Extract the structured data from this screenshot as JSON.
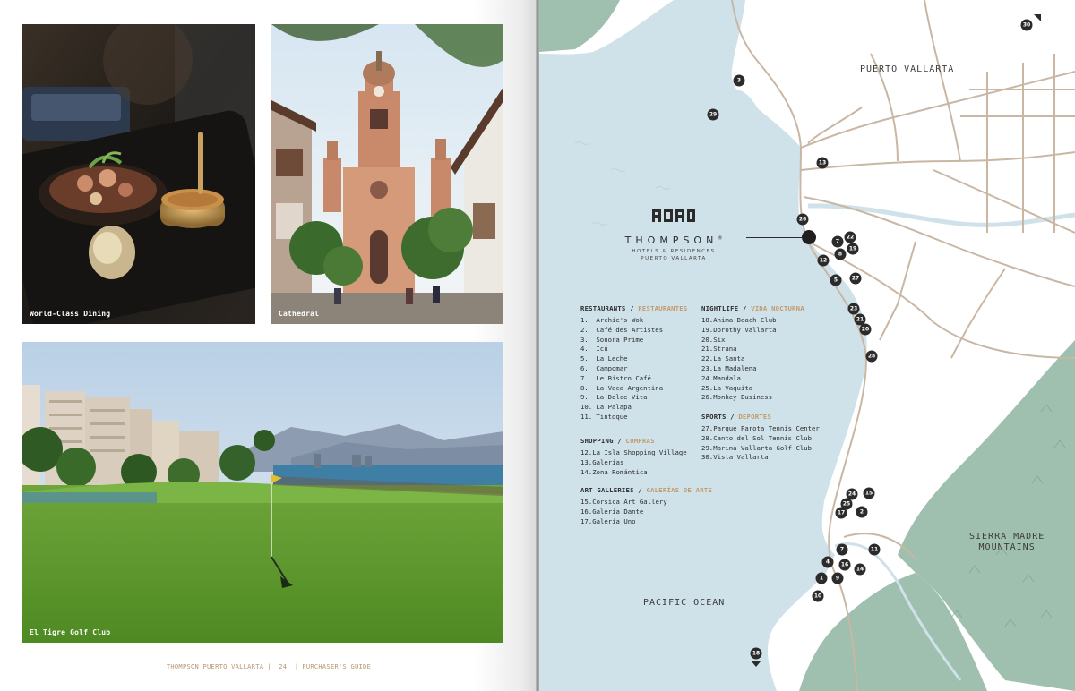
{
  "left_page": {
    "photos": [
      {
        "caption": "World-Class Dining"
      },
      {
        "caption": "Cathedral"
      },
      {
        "caption": "El Tigre Golf Club"
      }
    ],
    "footer": {
      "brand": "THOMPSON PUERTO VALLARTA",
      "separator": "|",
      "page_number": "24",
      "section": "PURCHASER'S GUIDE"
    }
  },
  "map": {
    "labels": {
      "city": "PUERTO VALLARTA",
      "ocean": "PACIFIC OCEAN",
      "mountains_line1": "SIERRA MADRE",
      "mountains_line2": "MOUNTAINS"
    },
    "brand": {
      "name": "THOMPSON",
      "registered": "®",
      "line1": "HOTELS & RESIDENCES",
      "line2": "PUERTO VALLARTA"
    },
    "markers": [
      "30",
      "3",
      "29",
      "13",
      "26",
      "22",
      "7",
      "19",
      "8",
      "12",
      "5",
      "27",
      "23",
      "21",
      "20",
      "28",
      "24",
      "15",
      "25",
      "17",
      "2",
      "7",
      "11",
      "4",
      "16",
      "14",
      "1",
      "9",
      "10",
      "18"
    ],
    "colors": {
      "water": "#cfe1e9",
      "land": "#ffffff",
      "mountains": "#9fbfaf",
      "roads": "#c9b7a4",
      "accent": "#c39a6b"
    }
  },
  "legend": {
    "restaurants": {
      "title_en": "RESTAURANTS",
      "slash": "/",
      "title_es": "RESTAURANTES",
      "items": [
        {
          "num": "1.",
          "name": "Archie's Wok"
        },
        {
          "num": "2.",
          "name": "Café des Artistes"
        },
        {
          "num": "3.",
          "name": "Sonora Prime"
        },
        {
          "num": "4.",
          "name": "Icú"
        },
        {
          "num": "5.",
          "name": "La Leche"
        },
        {
          "num": "6.",
          "name": "Campomar"
        },
        {
          "num": "7.",
          "name": "Le Bistro Café"
        },
        {
          "num": "8.",
          "name": "La Vaca Argentina"
        },
        {
          "num": "9.",
          "name": "La Dolce Vita"
        },
        {
          "num": "10.",
          "name": "La Palapa"
        },
        {
          "num": "11.",
          "name": "Tintoque"
        }
      ]
    },
    "shopping": {
      "title_en": "SHOPPING",
      "slash": "/",
      "title_es": "COMPRAS",
      "items": [
        {
          "num": "12.",
          "name": "La Isla Shopping Village"
        },
        {
          "num": "13.",
          "name": "Galerías"
        },
        {
          "num": "14.",
          "name": "Zona Romántica"
        }
      ]
    },
    "art": {
      "title_en": "ART GALLERIES",
      "slash": "/",
      "title_es": "GALERÍAS DE ARTE",
      "items": [
        {
          "num": "15.",
          "name": "Corsica Art Gallery"
        },
        {
          "num": "16.",
          "name": "Galería Dante"
        },
        {
          "num": "17.",
          "name": "Galería Uno"
        }
      ]
    },
    "nightlife": {
      "title_en": "NIGHTLIFE",
      "slash": "/",
      "title_es": "VIDA NOCTURNA",
      "items": [
        {
          "num": "18.",
          "name": "Anima Beach Club"
        },
        {
          "num": "19.",
          "name": "Dorothy Vallarta"
        },
        {
          "num": "20.",
          "name": "Six"
        },
        {
          "num": "21.",
          "name": "Strana"
        },
        {
          "num": "22.",
          "name": "La Santa"
        },
        {
          "num": "23.",
          "name": "La Madalena"
        },
        {
          "num": "24.",
          "name": "Mandala"
        },
        {
          "num": "25.",
          "name": "La Vaquita"
        },
        {
          "num": "26.",
          "name": "Monkey Business"
        }
      ]
    },
    "sports": {
      "title_en": "SPORTS",
      "slash": "/",
      "title_es": "DEPORTES",
      "items": [
        {
          "num": "27.",
          "name": "Parque Parota Tennis Center"
        },
        {
          "num": "28.",
          "name": "Canto del Sol Tennis Club"
        },
        {
          "num": "29.",
          "name": "Marina Vallarta Golf Club"
        },
        {
          "num": "30.",
          "name": "Vista Vallarta"
        }
      ]
    }
  }
}
